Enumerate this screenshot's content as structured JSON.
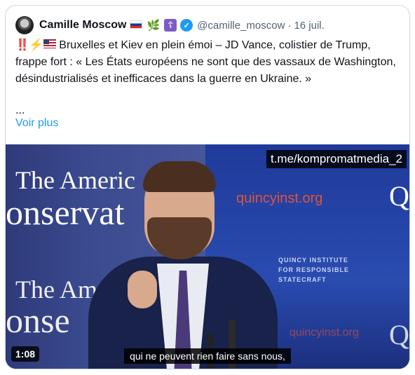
{
  "tweet": {
    "author_name": "Camille Moscow",
    "flag_icon": "russia-flag-icon",
    "branch_emoji": "🌿",
    "orthodox_cross": "☦",
    "verified_icon": "verified-badge-icon",
    "handle": "@camille_moscow",
    "separator": "·",
    "date": "16 juil.",
    "text_prefix_icons": "‼️⚡",
    "text": "Bruxelles et Kiev en plein émoi – JD Vance, colistier de Trump, frappe fort : « Les États européens ne sont que des vassaux de Washington, désindustrialisés et inefficaces dans la guerre en Ukraine. »",
    "ellipsis": "...",
    "show_more": "Voir plus"
  },
  "video": {
    "watermark": "t.me/kompromatmedia_2",
    "duration": "1:08",
    "subtitle": "qui ne peuvent rien faire sans nous,",
    "left_banner_line1": "The Americ",
    "left_banner_line2": "onservat",
    "left_banner_line3": "The Ame",
    "left_banner_line4": "onse",
    "right_site": "quincyinst.org",
    "right_site2": "quincyinst.org",
    "right_institute": "QUINCY INSTITUTE FOR RESPONSIBLE STATECRAFT",
    "right_logo_letter": "Q"
  },
  "colors": {
    "accent": "#1d9bf0",
    "text": "#0f1419",
    "muted": "#536471"
  }
}
